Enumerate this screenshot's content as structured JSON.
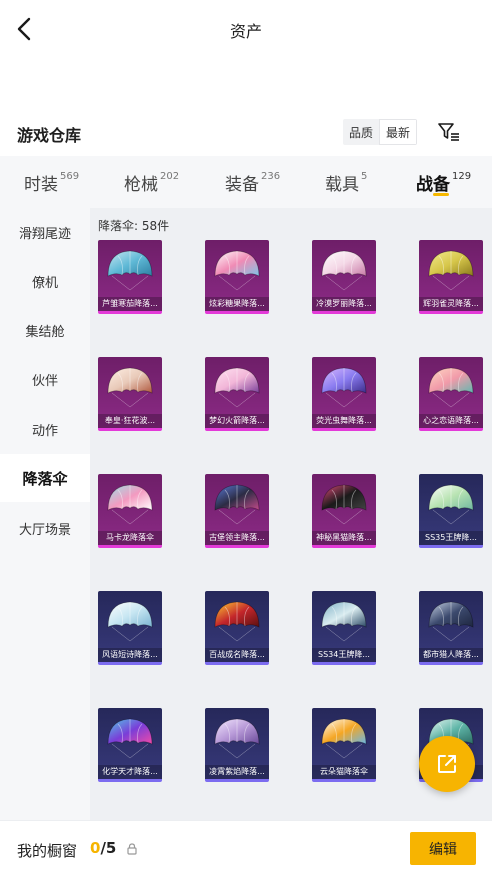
{
  "header": {
    "title": "资产",
    "back_icon": "back-arrow-icon"
  },
  "warehouse": {
    "title": "游戏仓库",
    "sort_options": [
      "品质",
      "最新"
    ],
    "active_sort": 1,
    "filter_icon": "filter-icon"
  },
  "tabs": [
    {
      "label": "时装",
      "count": "569"
    },
    {
      "label": "枪械",
      "count": "202"
    },
    {
      "label": "装备",
      "count": "236"
    },
    {
      "label": "载具",
      "count": "5"
    },
    {
      "label": "战备",
      "count": "129"
    }
  ],
  "active_tab": 4,
  "sidebar": {
    "items": [
      "滑翔尾迹",
      "僚机",
      "集结舱",
      "伙伴",
      "动作",
      "降落伞",
      "大厅场景"
    ],
    "active": 5
  },
  "content": {
    "count_label": "降落伞: 58件",
    "items": [
      {
        "name": "芦雏寒茄降落...",
        "tier": "purple",
        "colors": [
          "#5fb9d6",
          "#c9e7f2",
          "#2e7fa2"
        ]
      },
      {
        "name": "炫彩糖果降落...",
        "tier": "purple",
        "colors": [
          "#f08bb5",
          "#ffffff",
          "#7ec6e8"
        ]
      },
      {
        "name": "冷漠罗丽降落...",
        "tier": "purple",
        "colors": [
          "#f4d7e6",
          "#ffffff",
          "#c77aa6"
        ]
      },
      {
        "name": "辉羽雀灵降落...",
        "tier": "purple",
        "colors": [
          "#d6c64a",
          "#f3ea8f",
          "#8a7a1c"
        ]
      },
      {
        "name": "奉皇·狂花波...",
        "tier": "purple",
        "colors": [
          "#e8c9b8",
          "#fff0e6",
          "#b0583e"
        ]
      },
      {
        "name": "梦幻火箭降落...",
        "tier": "purple",
        "colors": [
          "#f2b6d8",
          "#ffe4f2",
          "#7a3e9a"
        ]
      },
      {
        "name": "荧光虫舞降落...",
        "tier": "purple",
        "colors": [
          "#8a7cf0",
          "#d9b8ff",
          "#3c2c8a"
        ]
      },
      {
        "name": "心之恋语降落...",
        "tier": "purple",
        "colors": [
          "#f19aa9",
          "#ffd9c4",
          "#5fb8b0"
        ]
      },
      {
        "name": "马卡龙降落伞",
        "tier": "purple",
        "colors": [
          "#f39ac0",
          "#9de0e6",
          "#ffffff"
        ]
      },
      {
        "name": "古堡领主降落...",
        "tier": "purple",
        "colors": [
          "#2c2c44",
          "#5a7ad8",
          "#c24a8a"
        ]
      },
      {
        "name": "神秘黑猫降落...",
        "tier": "purple",
        "colors": [
          "#1a1a1a",
          "#e04a7a",
          "#444444"
        ]
      },
      {
        "name": "SS35王牌降...",
        "tier": "blue",
        "colors": [
          "#b8e3b2",
          "#ffffff",
          "#6fb7a0"
        ]
      },
      {
        "name": "风语短诗降落...",
        "tier": "blue",
        "colors": [
          "#c7e6f2",
          "#ffffff",
          "#7bb4d2"
        ]
      },
      {
        "name": "百战成名降落...",
        "tier": "blue",
        "colors": [
          "#c4262b",
          "#ffcc33",
          "#5a1010"
        ]
      },
      {
        "name": "SS34王牌降...",
        "tier": "blue",
        "colors": [
          "#d9ecf0",
          "#7fb0c6",
          "#2c4a66"
        ]
      },
      {
        "name": "都市猎人降落...",
        "tier": "blue",
        "colors": [
          "#3c4a6e",
          "#c8d4e6",
          "#1e2640"
        ]
      },
      {
        "name": "化学天才降落...",
        "tier": "blue",
        "colors": [
          "#7a3ed8",
          "#52c8e6",
          "#f04aa8"
        ]
      },
      {
        "name": "凌霄紫焰降落...",
        "tier": "blue",
        "colors": [
          "#b89ad8",
          "#f4e9ff",
          "#6a4a9a"
        ]
      },
      {
        "name": "云朵猫降落伞",
        "tier": "blue",
        "colors": [
          "#f5a623",
          "#ffffff",
          "#6ab7e6"
        ]
      },
      {
        "name": "",
        "tier": "blue",
        "colors": [
          "#5fb6a8",
          "#e8f6f2",
          "#2e6f66"
        ]
      }
    ]
  },
  "fab": {
    "icon": "share-icon"
  },
  "showcase": {
    "label": "我的橱窗",
    "current": "0",
    "total": "/5",
    "lock_icon": "lock-icon",
    "edit_label": "编辑"
  }
}
